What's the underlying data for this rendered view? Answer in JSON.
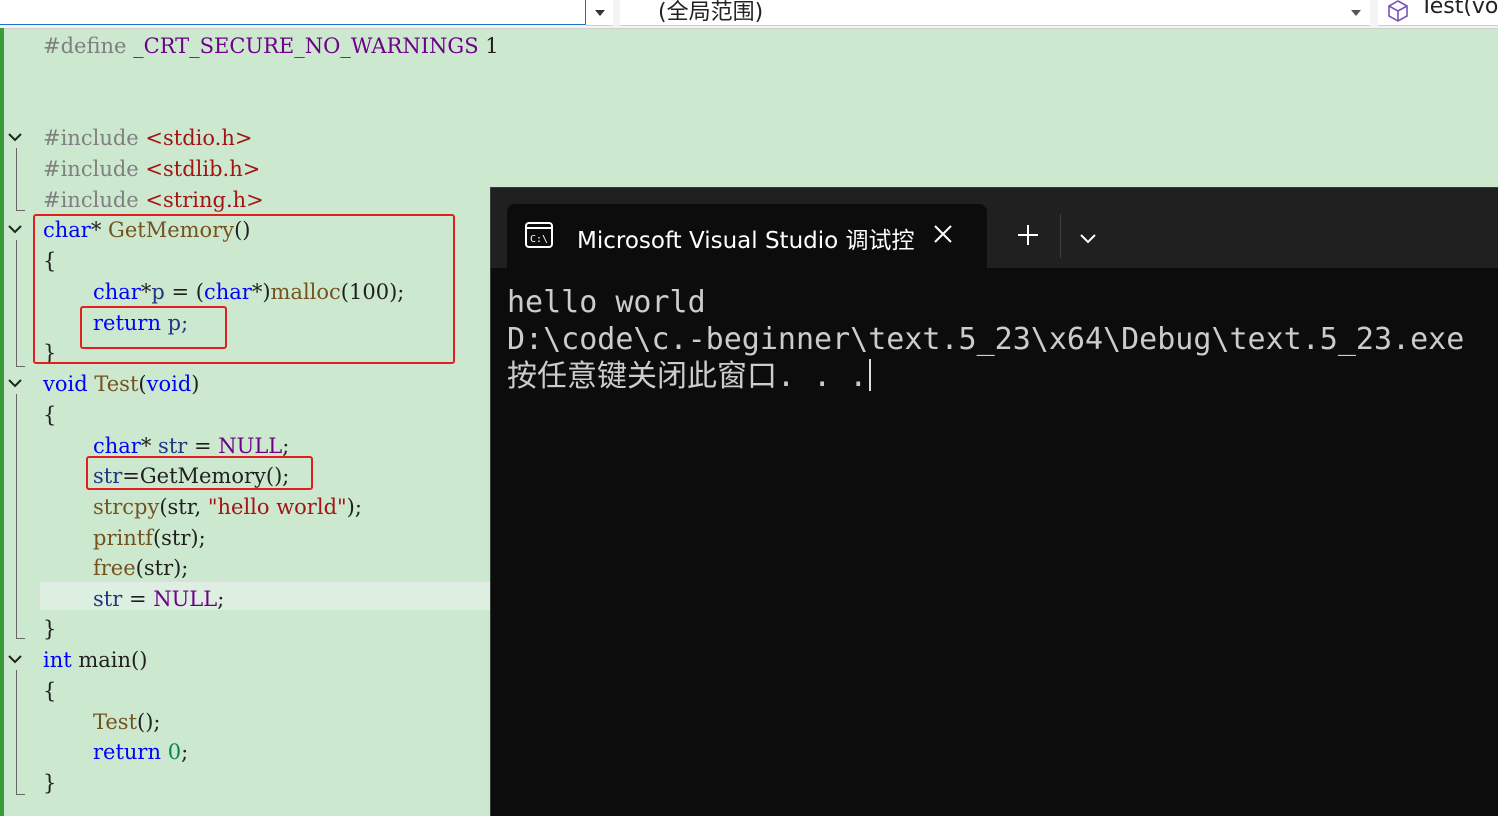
{
  "nav": {
    "left_value": "",
    "scope_label": "(全局范围)",
    "member_label": "Test(vo"
  },
  "code": {
    "define_kw": "#define",
    "define_macro": "_CRT_SECURE_NO_WARNINGS",
    "define_val": "1",
    "include_kw": "#include",
    "inc1": "<stdio.h>",
    "inc2": "<stdlib.h>",
    "inc3": "<string.h>",
    "char_kw": "char",
    "star": "*",
    "getmemory": "GetMemory",
    "parens": "()",
    "open_brace": "{",
    "close_brace": "}",
    "p_decl_p": "p",
    "p_decl_eq": " = (",
    "p_decl_cast_end": "*)",
    "malloc": "malloc",
    "malloc_args": "(100);",
    "return_kw": "return",
    "return_p": " p;",
    "void_kw": "void",
    "test_fn": "Test",
    "test_params_open": "(",
    "test_params_close": ")",
    "str_decl_star": "* ",
    "str_var": "str",
    "str_decl_eq": " = ",
    "null_macro": "NULL",
    "semicolon": ";",
    "assign_lhs": "str",
    "assign_rhs": "=GetMemory();",
    "strcpy": "strcpy",
    "strcpy_open": "(str, ",
    "hello_lit": "\"hello world\"",
    "strcpy_close": ");",
    "printf": "printf",
    "printf_args": "(str);",
    "free": "free",
    "free_args": "(str);",
    "str_null_eq": " = ",
    "int_kw": "int",
    "main_fn": " main()",
    "test_call": "Test",
    "test_call_args": "();",
    "return_zero_val": "0",
    "return_zero_semi": ";"
  },
  "terminal": {
    "tab_title": "Microsoft Visual Studio 调试控",
    "line1": "hello world",
    "line2": "D:\\code\\c.-beginner\\text.5_23\\x64\\Debug\\text.5_23.exe",
    "line3": "按任意键关闭此窗口. . ."
  },
  "icons": {
    "nav_dropdown": "chevron-down-icon",
    "member_icon": "cube-icon",
    "fold": "collapse-chevron-icon",
    "terminal_tab_icon": "console-icon",
    "terminal_close": "close-icon",
    "terminal_new_tab": "plus-icon",
    "terminal_dropdown": "chevron-down-icon"
  },
  "colors": {
    "editor_bg": "#cce8cf",
    "keyword": "#0000ff",
    "string": "#a31515",
    "macro": "#6f008a",
    "function": "#74531f",
    "highlight_box": "#e02020",
    "terminal_bg": "#0c0c0c"
  }
}
